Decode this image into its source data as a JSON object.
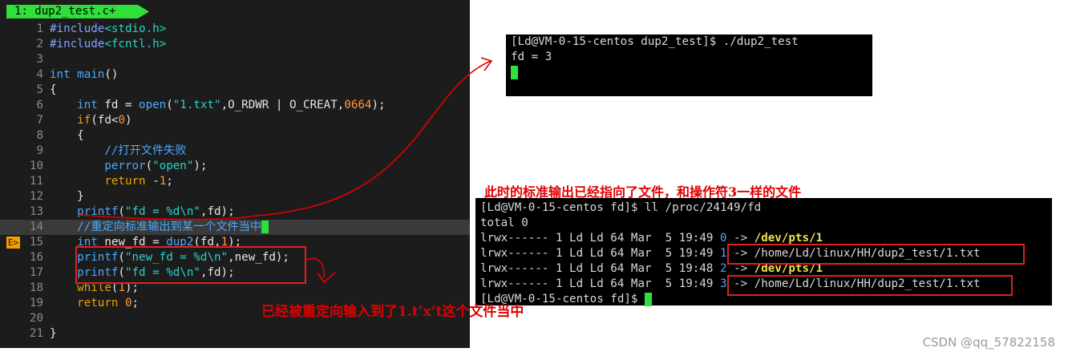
{
  "editor": {
    "tab_label": "1: dup2_test.c+",
    "marker": "E>",
    "lines": [
      {
        "n": "1",
        "tokens": [
          {
            "t": "#include",
            "c": "pp"
          },
          {
            "t": "<stdio.h>",
            "c": "str"
          }
        ]
      },
      {
        "n": "2",
        "tokens": [
          {
            "t": "#include",
            "c": "pp"
          },
          {
            "t": "<fcntl.h>",
            "c": "str"
          }
        ]
      },
      {
        "n": "3",
        "tokens": []
      },
      {
        "n": "4",
        "tokens": [
          {
            "t": "int",
            "c": "ty"
          },
          {
            "t": " ",
            "c": "tx"
          },
          {
            "t": "main",
            "c": "fn"
          },
          {
            "t": "()",
            "c": "tx"
          }
        ]
      },
      {
        "n": "5",
        "tokens": [
          {
            "t": "{",
            "c": "tx"
          }
        ]
      },
      {
        "n": "6",
        "tokens": [
          {
            "t": "    ",
            "c": "tx"
          },
          {
            "t": "int",
            "c": "ty"
          },
          {
            "t": " fd = ",
            "c": "tx"
          },
          {
            "t": "open",
            "c": "fn"
          },
          {
            "t": "(",
            "c": "tx"
          },
          {
            "t": "\"1.txt\"",
            "c": "str"
          },
          {
            "t": ",O_RDWR | O_CREAT,",
            "c": "tx"
          },
          {
            "t": "0664",
            "c": "num"
          },
          {
            "t": ");",
            "c": "tx"
          }
        ]
      },
      {
        "n": "7",
        "tokens": [
          {
            "t": "    ",
            "c": "tx"
          },
          {
            "t": "if",
            "c": "kw"
          },
          {
            "t": "(fd<",
            "c": "tx"
          },
          {
            "t": "0",
            "c": "num"
          },
          {
            "t": ")",
            "c": "tx"
          }
        ]
      },
      {
        "n": "8",
        "tokens": [
          {
            "t": "    {",
            "c": "tx"
          }
        ]
      },
      {
        "n": "9",
        "tokens": [
          {
            "t": "        ",
            "c": "tx"
          },
          {
            "t": "//打开文件失败",
            "c": "cm"
          }
        ]
      },
      {
        "n": "10",
        "tokens": [
          {
            "t": "        ",
            "c": "tx"
          },
          {
            "t": "perror",
            "c": "fn"
          },
          {
            "t": "(",
            "c": "tx"
          },
          {
            "t": "\"open\"",
            "c": "str"
          },
          {
            "t": ");",
            "c": "tx"
          }
        ]
      },
      {
        "n": "11",
        "tokens": [
          {
            "t": "        ",
            "c": "tx"
          },
          {
            "t": "return",
            "c": "kw"
          },
          {
            "t": " -",
            "c": "tx"
          },
          {
            "t": "1",
            "c": "num"
          },
          {
            "t": ";",
            "c": "tx"
          }
        ]
      },
      {
        "n": "12",
        "tokens": [
          {
            "t": "    }",
            "c": "tx"
          }
        ]
      },
      {
        "n": "13",
        "tokens": [
          {
            "t": "    ",
            "c": "tx"
          },
          {
            "t": "printf",
            "c": "fn"
          },
          {
            "t": "(",
            "c": "tx"
          },
          {
            "t": "\"fd = %d\\n\"",
            "c": "str"
          },
          {
            "t": ",fd);",
            "c": "tx"
          }
        ]
      },
      {
        "n": "14",
        "current": true,
        "tokens": [
          {
            "t": "    ",
            "c": "tx"
          },
          {
            "t": "//重定向标准输出到某一个文件当中",
            "c": "cm"
          },
          {
            "t": " ",
            "c": "cursorblk"
          }
        ]
      },
      {
        "n": "15",
        "mark": true,
        "tokens": [
          {
            "t": "    ",
            "c": "tx"
          },
          {
            "t": "int",
            "c": "ty"
          },
          {
            "t": " new_fd = ",
            "c": "tx"
          },
          {
            "t": "dup2",
            "c": "fn"
          },
          {
            "t": "(fd,",
            "c": "tx"
          },
          {
            "t": "1",
            "c": "num"
          },
          {
            "t": ");",
            "c": "tx"
          }
        ]
      },
      {
        "n": "16",
        "tokens": [
          {
            "t": "    ",
            "c": "tx"
          },
          {
            "t": "printf",
            "c": "fn"
          },
          {
            "t": "(",
            "c": "tx"
          },
          {
            "t": "\"new_fd = %d\\n\"",
            "c": "str"
          },
          {
            "t": ",new_fd);",
            "c": "tx"
          }
        ]
      },
      {
        "n": "17",
        "tokens": [
          {
            "t": "    ",
            "c": "tx"
          },
          {
            "t": "printf",
            "c": "fn"
          },
          {
            "t": "(",
            "c": "tx"
          },
          {
            "t": "\"fd = %d\\n\"",
            "c": "str"
          },
          {
            "t": ",fd);",
            "c": "tx"
          }
        ]
      },
      {
        "n": "18",
        "tokens": [
          {
            "t": "    ",
            "c": "tx"
          },
          {
            "t": "while",
            "c": "kw"
          },
          {
            "t": "(",
            "c": "tx"
          },
          {
            "t": "1",
            "c": "num"
          },
          {
            "t": ");",
            "c": "tx"
          }
        ]
      },
      {
        "n": "19",
        "tokens": [
          {
            "t": "    ",
            "c": "tx"
          },
          {
            "t": "return",
            "c": "kw"
          },
          {
            "t": " ",
            "c": "tx"
          },
          {
            "t": "0",
            "c": "num"
          },
          {
            "t": ";",
            "c": "tx"
          }
        ]
      },
      {
        "n": "20",
        "tokens": []
      },
      {
        "n": "21",
        "tokens": [
          {
            "t": "}",
            "c": "tx"
          }
        ]
      }
    ]
  },
  "terminal1": {
    "lines": [
      {
        "segments": [
          {
            "t": "[Ld@VM-0-15-centos dup2_test]$ ./dup2_test"
          }
        ]
      },
      {
        "segments": [
          {
            "t": "fd = 3"
          }
        ]
      }
    ]
  },
  "terminal2": {
    "lines": [
      {
        "segments": [
          {
            "t": "[Ld@VM-0-15-centos fd]$ ll /proc/24149/fd"
          }
        ]
      },
      {
        "segments": [
          {
            "t": "total 0"
          }
        ]
      },
      {
        "segments": [
          {
            "t": "lrwx------ 1 Ld Ld 64 Mar  5 19:49 "
          },
          {
            "t": "0",
            "c": "blue"
          },
          {
            "t": " -> "
          },
          {
            "t": "/dev/pts/1",
            "c": "ybold"
          }
        ]
      },
      {
        "segments": [
          {
            "t": "lrwx------ 1 Ld Ld 64 Mar  5 19:49 "
          },
          {
            "t": "1",
            "c": "blue"
          },
          {
            "t": " -> /home/Ld/linux/HH/dup2_test/1.txt"
          }
        ]
      },
      {
        "segments": [
          {
            "t": "lrwx------ 1 Ld Ld 64 Mar  5 19:48 "
          },
          {
            "t": "2",
            "c": "blue"
          },
          {
            "t": " -> "
          },
          {
            "t": "/dev/pts/1",
            "c": "ybold"
          }
        ]
      },
      {
        "segments": [
          {
            "t": "lrwx------ 1 Ld Ld 64 Mar  5 19:49 "
          },
          {
            "t": "3",
            "c": "blue"
          },
          {
            "t": " -> /home/Ld/linux/HH/dup2_test/1.txt"
          }
        ]
      },
      {
        "segments": [
          {
            "t": "[Ld@VM-0-15-centos fd]$ "
          }
        ]
      }
    ]
  },
  "annotations": {
    "stdout_note": "此时的标准输出已经指向了文件，和操作符3一样的文件",
    "redirect_note": "已经被重定向输入到了1.t’x’t这个文件当中"
  },
  "watermark": "CSDN @qq_57822158",
  "colors": {
    "accent_green": "#2fe03b",
    "annotation_red": "#e00000"
  }
}
